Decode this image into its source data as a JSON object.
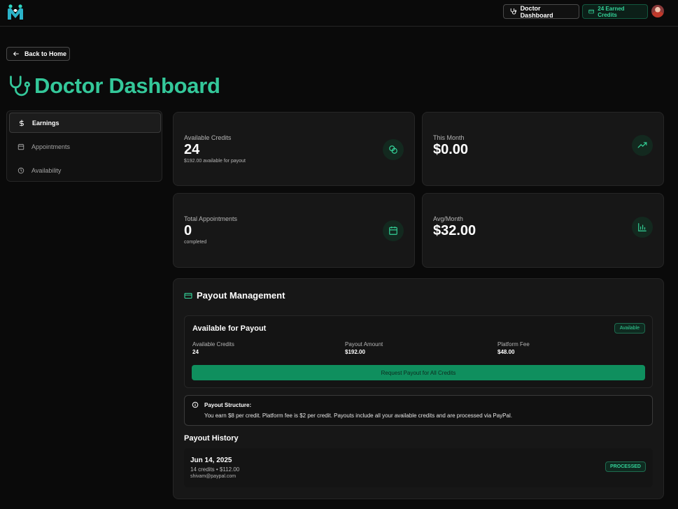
{
  "header": {
    "dashboard_label": "Doctor Dashboard",
    "credits_label": "24 Earned Credits",
    "accent": "#34c89a"
  },
  "nav": {
    "back_label": "Back to Home"
  },
  "page": {
    "title": "Doctor Dashboard"
  },
  "sidebar": {
    "items": [
      {
        "label": "Earnings",
        "icon": "dollar-icon",
        "active": true
      },
      {
        "label": "Appointments",
        "icon": "calendar-icon",
        "active": false
      },
      {
        "label": "Availability",
        "icon": "clock-icon",
        "active": false
      }
    ]
  },
  "stats": [
    {
      "label": "Available Credits",
      "value": "24",
      "sub": "$192.00 available for payout",
      "icon": "coins-icon"
    },
    {
      "label": "This Month",
      "value": "$0.00",
      "sub": "",
      "icon": "trending-up-icon"
    },
    {
      "label": "Total Appointments",
      "value": "0",
      "sub": "completed",
      "icon": "calendar-icon"
    },
    {
      "label": "Avg/Month",
      "value": "$32.00",
      "sub": "",
      "icon": "bar-chart-icon"
    }
  ],
  "payout": {
    "title": "Payout Management",
    "available": {
      "heading": "Available for Payout",
      "badge": "Available",
      "columns": [
        {
          "label": "Available Credits",
          "value": "24"
        },
        {
          "label": "Payout Amount",
          "value": "$192.00"
        },
        {
          "label": "Platform Fee",
          "value": "$48.00"
        }
      ],
      "button": "Request Payout for All Credits"
    },
    "structure": {
      "title": "Payout Structure:",
      "description": "You earn $8 per credit. Platform fee is $2 per credit. Payouts include all your available credits and are processed via PayPal."
    },
    "history_title": "Payout History",
    "history": [
      {
        "date": "Jun 14, 2025",
        "amount": "14 credits • $112.00",
        "email": "shivam@paypal.com",
        "status": "PROCESSED"
      }
    ]
  }
}
